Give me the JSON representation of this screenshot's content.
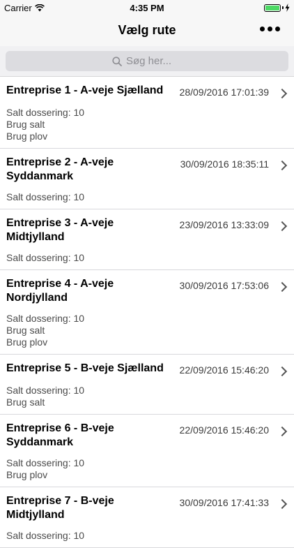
{
  "status_bar": {
    "carrier": "Carrier",
    "time": "4:35 PM",
    "battery_level": 1.0
  },
  "nav": {
    "title": "Vælg rute"
  },
  "search": {
    "placeholder": "Søg her..."
  },
  "routes": [
    {
      "title": "Entreprise 1 - A-veje Sjælland",
      "date": "28/09/2016 17:01:39",
      "details": [
        "Salt dossering: 10",
        "Brug salt",
        "Brug plov"
      ]
    },
    {
      "title": "Entreprise 2 - A-veje Syddanmark",
      "date": "30/09/2016 18:35:11",
      "details": [
        "Salt dossering: 10"
      ]
    },
    {
      "title": "Entreprise 3 - A-veje Midtjylland",
      "date": "23/09/2016 13:33:09",
      "details": [
        "Salt dossering: 10"
      ]
    },
    {
      "title": "Entreprise 4 - A-veje Nordjylland",
      "date": "30/09/2016 17:53:06",
      "details": [
        "Salt dossering: 10",
        "Brug salt",
        "Brug plov"
      ]
    },
    {
      "title": "Entreprise 5 - B-veje Sjælland",
      "date": "22/09/2016 15:46:20",
      "details": [
        "Salt dossering: 10",
        "Brug salt"
      ]
    },
    {
      "title": "Entreprise 6 - B-veje Syddanmark",
      "date": "22/09/2016 15:46:20",
      "details": [
        "Salt dossering: 10",
        "Brug plov"
      ]
    },
    {
      "title": "Entreprise 7 - B-veje Midtjylland",
      "date": "30/09/2016 17:41:33",
      "details": [
        "Salt dossering: 10"
      ]
    }
  ]
}
